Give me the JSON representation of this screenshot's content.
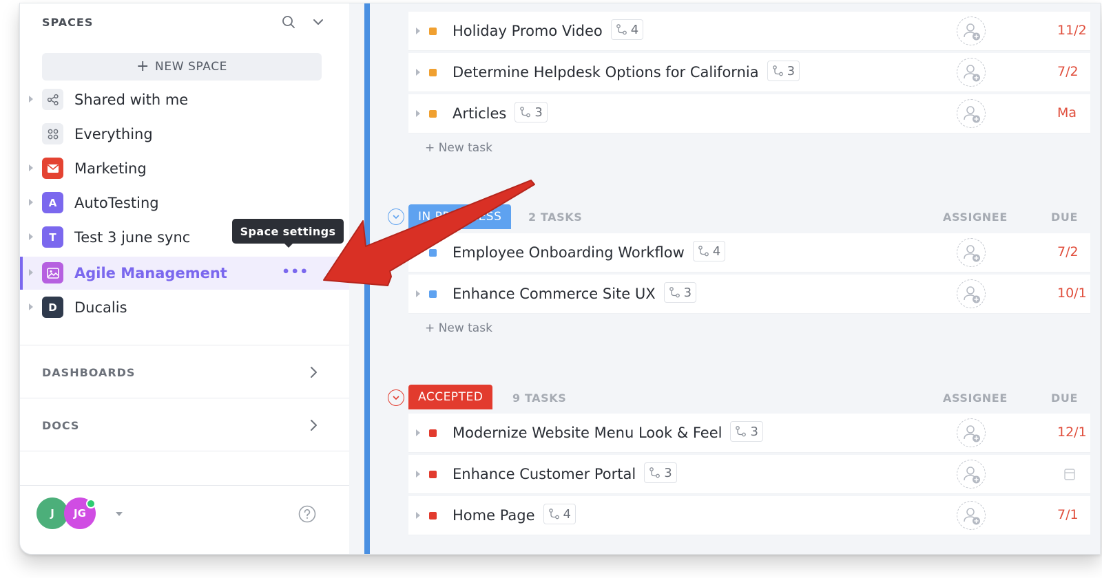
{
  "sidebar": {
    "spaces_title": "SPACES",
    "new_space_label": "NEW SPACE",
    "items": [
      {
        "label": "Shared with me",
        "icon": "share-icon"
      },
      {
        "label": "Everything",
        "icon": "grid-icon"
      },
      {
        "label": "Marketing",
        "icon": "mail-icon",
        "color": "#e44332"
      },
      {
        "label": "AutoTesting",
        "icon_letter": "A",
        "color": "#7b68ee"
      },
      {
        "label": "Test 3 june sync",
        "icon_letter": "T",
        "color": "#7b68ee"
      },
      {
        "label": "Agile Management",
        "icon": "image-icon",
        "color": "#b660e0",
        "active": true
      },
      {
        "label": "Ducalis",
        "icon_letter": "D",
        "color": "#2f3a4c"
      }
    ],
    "tooltip": "Space settings",
    "more_label": "•••",
    "dashboards_label": "DASHBOARDS",
    "docs_label": "DOCS",
    "avatars": [
      {
        "initials": "J",
        "color": "#4caf7a"
      },
      {
        "initials": "JG",
        "color": "#d04de3"
      }
    ]
  },
  "main": {
    "accent": "#4a90e2",
    "top_rows": [
      {
        "name": "Holiday Promo Video",
        "subtasks": "4",
        "due": "11/2",
        "color": "#f0a030"
      },
      {
        "name": "Determine Helpdesk Options for California",
        "subtasks": "3",
        "due": "7/2",
        "color": "#f0a030"
      },
      {
        "name": "Articles",
        "subtasks": "3",
        "due": "Ma",
        "color": "#f0a030"
      }
    ],
    "new_task_label": "+ New task",
    "in_progress": {
      "status": "IN PROGRESS",
      "count": "2 TASKS",
      "assignee_header": "ASSIGNEE",
      "due_header": "DUE",
      "color": "#5ea2f0",
      "rows": [
        {
          "name": "Employee Onboarding Workflow",
          "subtasks": "4",
          "due": "7/2"
        },
        {
          "name": "Enhance Commerce Site UX",
          "subtasks": "3",
          "due": "10/1"
        }
      ]
    },
    "accepted": {
      "status": "ACCEPTED",
      "count": "9 TASKS",
      "assignee_header": "ASSIGNEE",
      "due_header": "DUE",
      "color": "#e23b2e",
      "rows": [
        {
          "name": "Modernize Website Menu Look & Feel",
          "subtasks": "3",
          "due": "12/1"
        },
        {
          "name": "Enhance Customer Portal",
          "subtasks": "3",
          "due": ""
        },
        {
          "name": "Home Page",
          "subtasks": "4",
          "due": "7/1"
        }
      ]
    }
  },
  "annotation": {
    "arrow_color": "#d93025"
  }
}
